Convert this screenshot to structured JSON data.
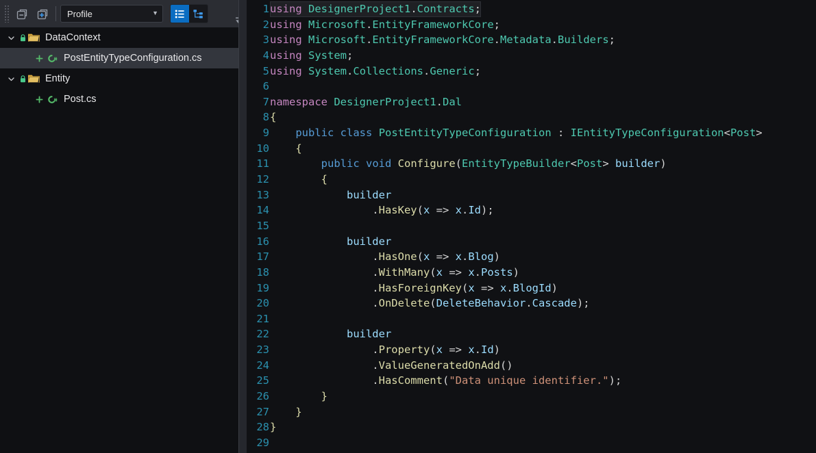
{
  "explorer": {
    "toolbar": {
      "collapse_all_label": "Collapse All",
      "expand_all_label": "Expand All",
      "profile_value": "Profile",
      "profile_placeholder": "Profile",
      "view_list_label": "List View",
      "view_tree_label": "Tree View",
      "overflow_label": "More"
    },
    "tree": [
      {
        "label": "DataContext",
        "type": "folder",
        "expanded": true,
        "locked": true,
        "selected": false
      },
      {
        "label": "PostEntityTypeConfiguration.cs",
        "type": "file",
        "added": true,
        "selected": true
      },
      {
        "label": "Entity",
        "type": "folder",
        "expanded": true,
        "locked": true,
        "selected": false
      },
      {
        "label": "Post.cs",
        "type": "file",
        "added": true,
        "selected": false
      }
    ]
  },
  "editor": {
    "file_name": "PostEntityTypeConfiguration.cs",
    "language": "csharp",
    "first_line_number": 1,
    "last_line_number": 29,
    "highlighted_line": 1,
    "colors": {
      "background": "#101114",
      "line_number": "#2b91af",
      "keyword": "#c586c0",
      "keyword_modifier": "#569cd6",
      "type": "#4ec9b0",
      "method": "#dcdcaa",
      "variable": "#9cdcfe",
      "string": "#ce9178",
      "punctuation": "#d4d4d4"
    },
    "lines": [
      {
        "n": 1,
        "tokens": [
          [
            "t-kw",
            "using"
          ],
          [
            "t-pn",
            " "
          ],
          [
            "t-type",
            "DesignerProject1"
          ],
          [
            "t-pn",
            "."
          ],
          [
            "t-type",
            "Contracts"
          ],
          [
            "t-pn",
            ";"
          ]
        ]
      },
      {
        "n": 2,
        "tokens": [
          [
            "t-kw",
            "using"
          ],
          [
            "t-pn",
            " "
          ],
          [
            "t-type",
            "Microsoft"
          ],
          [
            "t-pn",
            "."
          ],
          [
            "t-type",
            "EntityFrameworkCore"
          ],
          [
            "t-pn",
            ";"
          ]
        ]
      },
      {
        "n": 3,
        "tokens": [
          [
            "t-kw",
            "using"
          ],
          [
            "t-pn",
            " "
          ],
          [
            "t-type",
            "Microsoft"
          ],
          [
            "t-pn",
            "."
          ],
          [
            "t-type",
            "EntityFrameworkCore"
          ],
          [
            "t-pn",
            "."
          ],
          [
            "t-type",
            "Metadata"
          ],
          [
            "t-pn",
            "."
          ],
          [
            "t-type",
            "Builders"
          ],
          [
            "t-pn",
            ";"
          ]
        ]
      },
      {
        "n": 4,
        "tokens": [
          [
            "t-kw",
            "using"
          ],
          [
            "t-pn",
            " "
          ],
          [
            "t-type",
            "System"
          ],
          [
            "t-pn",
            ";"
          ]
        ]
      },
      {
        "n": 5,
        "tokens": [
          [
            "t-kw",
            "using"
          ],
          [
            "t-pn",
            " "
          ],
          [
            "t-type",
            "System"
          ],
          [
            "t-pn",
            "."
          ],
          [
            "t-type",
            "Collections"
          ],
          [
            "t-pn",
            "."
          ],
          [
            "t-type",
            "Generic"
          ],
          [
            "t-pn",
            ";"
          ]
        ]
      },
      {
        "n": 6,
        "tokens": []
      },
      {
        "n": 7,
        "tokens": [
          [
            "t-kw",
            "namespace"
          ],
          [
            "t-pn",
            " "
          ],
          [
            "t-type",
            "DesignerProject1"
          ],
          [
            "t-pn",
            "."
          ],
          [
            "t-type",
            "Dal"
          ]
        ]
      },
      {
        "n": 8,
        "tokens": [
          [
            "t-brace",
            "{"
          ]
        ]
      },
      {
        "n": 9,
        "tokens": [
          [
            "t-pn",
            "    "
          ],
          [
            "t-kw2",
            "public"
          ],
          [
            "t-pn",
            " "
          ],
          [
            "t-kw2",
            "class"
          ],
          [
            "t-pn",
            " "
          ],
          [
            "t-type",
            "PostEntityTypeConfiguration"
          ],
          [
            "t-pn",
            " : "
          ],
          [
            "t-type",
            "IEntityTypeConfiguration"
          ],
          [
            "t-pn",
            "<"
          ],
          [
            "t-type",
            "Post"
          ],
          [
            "t-pn",
            ">"
          ]
        ]
      },
      {
        "n": 10,
        "tokens": [
          [
            "t-pn",
            "    "
          ],
          [
            "t-brace",
            "{"
          ]
        ]
      },
      {
        "n": 11,
        "tokens": [
          [
            "t-pn",
            "        "
          ],
          [
            "t-kw2",
            "public"
          ],
          [
            "t-pn",
            " "
          ],
          [
            "t-kw2",
            "void"
          ],
          [
            "t-pn",
            " "
          ],
          [
            "t-fn",
            "Configure"
          ],
          [
            "t-pn",
            "("
          ],
          [
            "t-type",
            "EntityTypeBuilder"
          ],
          [
            "t-pn",
            "<"
          ],
          [
            "t-type",
            "Post"
          ],
          [
            "t-pn",
            "> "
          ],
          [
            "t-var",
            "builder"
          ],
          [
            "t-pn",
            ")"
          ]
        ]
      },
      {
        "n": 12,
        "tokens": [
          [
            "t-pn",
            "        "
          ],
          [
            "t-brace",
            "{"
          ]
        ]
      },
      {
        "n": 13,
        "tokens": [
          [
            "t-pn",
            "            "
          ],
          [
            "t-var",
            "builder"
          ]
        ]
      },
      {
        "n": 14,
        "tokens": [
          [
            "t-pn",
            "                ."
          ],
          [
            "t-fn",
            "HasKey"
          ],
          [
            "t-pn",
            "("
          ],
          [
            "t-var",
            "x"
          ],
          [
            "t-pn",
            " => "
          ],
          [
            "t-var",
            "x"
          ],
          [
            "t-pn",
            "."
          ],
          [
            "t-var",
            "Id"
          ],
          [
            "t-pn",
            ");"
          ]
        ]
      },
      {
        "n": 15,
        "tokens": []
      },
      {
        "n": 16,
        "tokens": [
          [
            "t-pn",
            "            "
          ],
          [
            "t-var",
            "builder"
          ]
        ]
      },
      {
        "n": 17,
        "tokens": [
          [
            "t-pn",
            "                ."
          ],
          [
            "t-fn",
            "HasOne"
          ],
          [
            "t-pn",
            "("
          ],
          [
            "t-var",
            "x"
          ],
          [
            "t-pn",
            " => "
          ],
          [
            "t-var",
            "x"
          ],
          [
            "t-pn",
            "."
          ],
          [
            "t-var",
            "Blog"
          ],
          [
            "t-pn",
            ")"
          ]
        ]
      },
      {
        "n": 18,
        "tokens": [
          [
            "t-pn",
            "                ."
          ],
          [
            "t-fn",
            "WithMany"
          ],
          [
            "t-pn",
            "("
          ],
          [
            "t-var",
            "x"
          ],
          [
            "t-pn",
            " => "
          ],
          [
            "t-var",
            "x"
          ],
          [
            "t-pn",
            "."
          ],
          [
            "t-var",
            "Posts"
          ],
          [
            "t-pn",
            ")"
          ]
        ]
      },
      {
        "n": 19,
        "tokens": [
          [
            "t-pn",
            "                ."
          ],
          [
            "t-fn",
            "HasForeignKey"
          ],
          [
            "t-pn",
            "("
          ],
          [
            "t-var",
            "x"
          ],
          [
            "t-pn",
            " => "
          ],
          [
            "t-var",
            "x"
          ],
          [
            "t-pn",
            "."
          ],
          [
            "t-var",
            "BlogId"
          ],
          [
            "t-pn",
            ")"
          ]
        ]
      },
      {
        "n": 20,
        "tokens": [
          [
            "t-pn",
            "                ."
          ],
          [
            "t-fn",
            "OnDelete"
          ],
          [
            "t-pn",
            "("
          ],
          [
            "t-var",
            "DeleteBehavior"
          ],
          [
            "t-pn",
            "."
          ],
          [
            "t-var",
            "Cascade"
          ],
          [
            "t-pn",
            ");"
          ]
        ]
      },
      {
        "n": 21,
        "tokens": []
      },
      {
        "n": 22,
        "tokens": [
          [
            "t-pn",
            "            "
          ],
          [
            "t-var",
            "builder"
          ]
        ]
      },
      {
        "n": 23,
        "tokens": [
          [
            "t-pn",
            "                ."
          ],
          [
            "t-fn",
            "Property"
          ],
          [
            "t-pn",
            "("
          ],
          [
            "t-var",
            "x"
          ],
          [
            "t-pn",
            " => "
          ],
          [
            "t-var",
            "x"
          ],
          [
            "t-pn",
            "."
          ],
          [
            "t-var",
            "Id"
          ],
          [
            "t-pn",
            ")"
          ]
        ]
      },
      {
        "n": 24,
        "tokens": [
          [
            "t-pn",
            "                ."
          ],
          [
            "t-fn",
            "ValueGeneratedOnAdd"
          ],
          [
            "t-pn",
            "()"
          ]
        ]
      },
      {
        "n": 25,
        "tokens": [
          [
            "t-pn",
            "                ."
          ],
          [
            "t-fn",
            "HasComment"
          ],
          [
            "t-pn",
            "("
          ],
          [
            "t-str",
            "\"Data unique identifier.\""
          ],
          [
            "t-pn",
            ");"
          ]
        ]
      },
      {
        "n": 26,
        "tokens": [
          [
            "t-pn",
            "        "
          ],
          [
            "t-brace",
            "}"
          ]
        ]
      },
      {
        "n": 27,
        "tokens": [
          [
            "t-pn",
            "    "
          ],
          [
            "t-brace",
            "}"
          ]
        ]
      },
      {
        "n": 28,
        "tokens": [
          [
            "t-brace",
            "}"
          ]
        ]
      },
      {
        "n": 29,
        "tokens": []
      }
    ],
    "plain_text": "using DesignerProject1.Contracts;\nusing Microsoft.EntityFrameworkCore;\nusing Microsoft.EntityFrameworkCore.Metadata.Builders;\nusing System;\nusing System.Collections.Generic;\n\nnamespace DesignerProject1.Dal\n{\n    public class PostEntityTypeConfiguration : IEntityTypeConfiguration<Post>\n    {\n        public void Configure(EntityTypeBuilder<Post> builder)\n        {\n            builder\n                .HasKey(x => x.Id);\n\n            builder\n                .HasOne(x => x.Blog)\n                .WithMany(x => x.Posts)\n                .HasForeignKey(x => x.BlogId)\n                .OnDelete(DeleteBehavior.Cascade);\n\n            builder\n                .Property(x => x.Id)\n                .ValueGeneratedOnAdd()\n                .HasComment(\"Data unique identifier.\");\n        }\n    }\n}\n"
  }
}
